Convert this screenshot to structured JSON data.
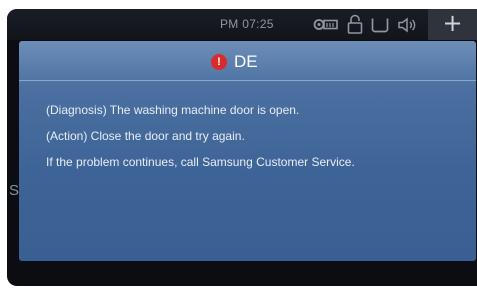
{
  "status_bar": {
    "time": "PM 07:25",
    "icons": [
      "key-icon",
      "lock-icon",
      "basket-icon",
      "sound-icon"
    ],
    "plus_label": "+"
  },
  "background": {
    "partial_text": "S"
  },
  "dialog": {
    "error_icon_glyph": "!",
    "error_code": "DE",
    "error_color": "#d92b2b",
    "lines": [
      "(Diagnosis) The washing machine door is open.",
      "(Action) Close the door and try again.",
      "If the problem continues, call Samsung Customer Service."
    ]
  }
}
